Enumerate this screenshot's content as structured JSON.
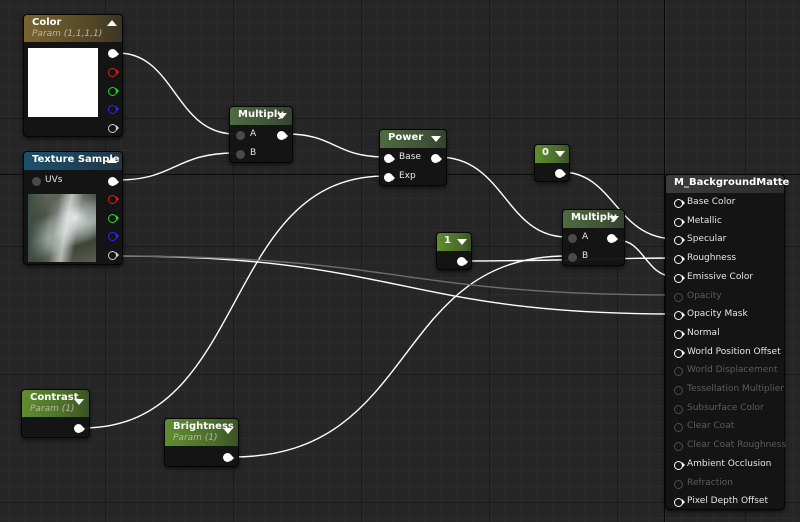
{
  "nodes": {
    "color": {
      "title": "Color",
      "subtitle": "Param (1,1,1,1)"
    },
    "texture_sample": {
      "title": "Texture Sample",
      "uvs_label": "UVs"
    },
    "multiply_1": {
      "title": "Multiply",
      "input_a": "A",
      "input_b": "B"
    },
    "power": {
      "title": "Power",
      "input_base": "Base",
      "input_exp": "Exp"
    },
    "constant_0": {
      "title": "0"
    },
    "constant_1": {
      "title": "1"
    },
    "multiply_2": {
      "title": "Multiply",
      "input_a": "A",
      "input_b": "B"
    },
    "contrast": {
      "title": "Contrast",
      "subtitle": "Param (1)"
    },
    "brightness": {
      "title": "Brightness",
      "subtitle": "Param (1)"
    },
    "material": {
      "title": "M_BackgroundMatte",
      "inputs": [
        {
          "label": "Base Color",
          "enabled": true
        },
        {
          "label": "Metallic",
          "enabled": true
        },
        {
          "label": "Specular",
          "enabled": true
        },
        {
          "label": "Roughness",
          "enabled": true
        },
        {
          "label": "Emissive Color",
          "enabled": true
        },
        {
          "label": "Opacity",
          "enabled": false
        },
        {
          "label": "Opacity Mask",
          "enabled": true
        },
        {
          "label": "Normal",
          "enabled": true
        },
        {
          "label": "World Position Offset",
          "enabled": true
        },
        {
          "label": "World Displacement",
          "enabled": false
        },
        {
          "label": "Tessellation Multiplier",
          "enabled": false
        },
        {
          "label": "Subsurface Color",
          "enabled": false
        },
        {
          "label": "Clear Coat",
          "enabled": false
        },
        {
          "label": "Clear Coat Roughness",
          "enabled": false
        },
        {
          "label": "Ambient Occlusion",
          "enabled": true
        },
        {
          "label": "Refraction",
          "enabled": false
        },
        {
          "label": "Pixel Depth Offset",
          "enabled": true
        }
      ]
    }
  },
  "colors": {
    "wire": "#ffffff",
    "wire_faint": "#6e6e6e",
    "param_header": "#5f8d2f",
    "texture_header": "#1d4f6d",
    "vector_param_header": "#7a6531",
    "math_header": "#4e6b3f"
  },
  "icons": {
    "collapse": "caret-down-icon",
    "expand": "caret-up-icon",
    "pin": "pin-icon"
  }
}
